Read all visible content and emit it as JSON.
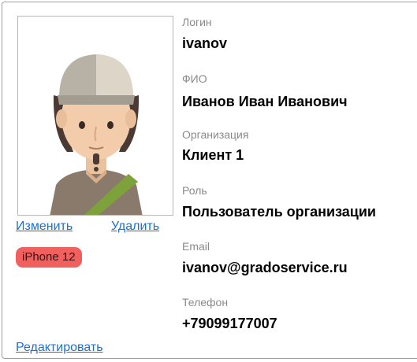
{
  "profile": {
    "photo_alt": "avatar",
    "actions": {
      "change": "Изменить",
      "delete": "Удалить",
      "edit": "Редактировать"
    },
    "device_badge": "iPhone 12",
    "device_badge_color": "#f0605f",
    "link_color": "#1b6fd6",
    "fields": {
      "login": {
        "label": "Логин",
        "value": "ivanov"
      },
      "fio": {
        "label": "ФИО",
        "value": "Иванов Иван Иванович"
      },
      "organization": {
        "label": "Организация",
        "value": "Клиент 1"
      },
      "role": {
        "label": "Роль",
        "value": "Пользователь организации"
      },
      "email": {
        "label": "Email",
        "value": "ivanov@gradoservice.ru"
      },
      "phone": {
        "label": "Телефон",
        "value": "+79099177007"
      }
    }
  }
}
